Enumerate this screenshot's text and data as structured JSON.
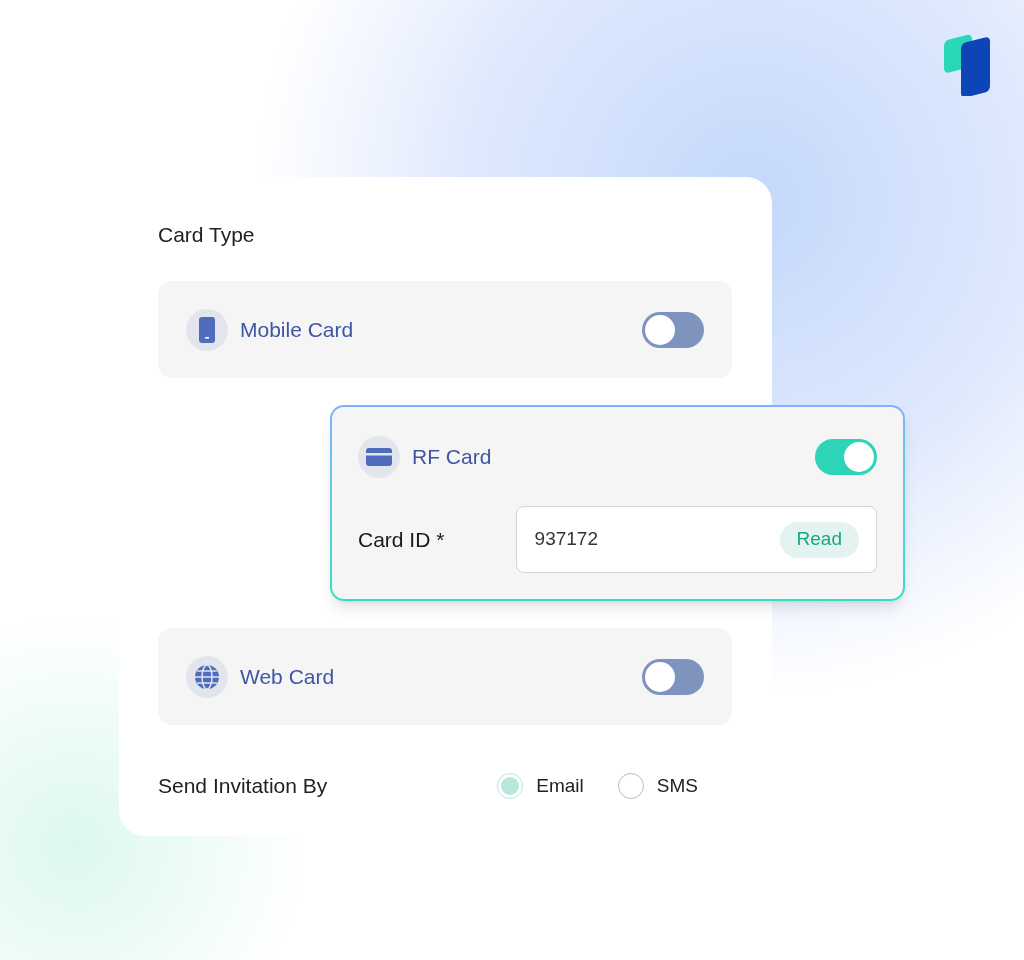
{
  "section_title": "Card Type",
  "cards": [
    {
      "kind": "mobile",
      "label": "Mobile Card",
      "on": false
    },
    {
      "kind": "rf",
      "label": "RF Card",
      "on": true,
      "field": {
        "label": "Card ID *",
        "value": "937172",
        "button": "Read"
      }
    },
    {
      "kind": "web",
      "label": "Web Card",
      "on": false
    }
  ],
  "invitation": {
    "label": "Send Invitation By",
    "options": [
      {
        "label": "Email",
        "selected": true
      },
      {
        "label": "SMS",
        "selected": false
      }
    ]
  }
}
